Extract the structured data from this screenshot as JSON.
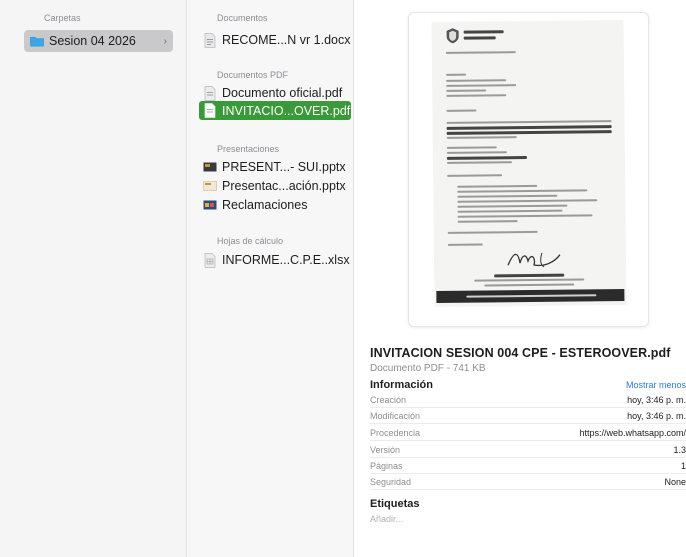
{
  "col1": {
    "header": "Carpetas",
    "folder": "Sesion 04 2026"
  },
  "col2": {
    "sections": [
      {
        "title": "Documentos",
        "items": [
          {
            "name": "RECOME...N vr 1.docx",
            "icon": "docx-file-icon"
          }
        ]
      },
      {
        "title": "Documentos PDF",
        "items": [
          {
            "name": "Documento oficial.pdf",
            "icon": "pdf-file-icon"
          },
          {
            "name": "INVITACIO...OVER.pdf",
            "icon": "pdf-file-icon",
            "selected": true
          }
        ]
      },
      {
        "title": "Presentaciones",
        "items": [
          {
            "name": "PRESENT...- SUI.pptx",
            "icon": "pptx-file-icon"
          },
          {
            "name": "Presentac...ación.pptx",
            "icon": "pptx-file-icon"
          },
          {
            "name": "Reclamaciones",
            "icon": "keynote-file-icon"
          }
        ]
      },
      {
        "title": "Hojas de cálculo",
        "items": [
          {
            "name": "INFORME...C.P.E..xlsx",
            "icon": "xlsx-file-icon"
          }
        ]
      }
    ]
  },
  "preview": {
    "title": "INVITACION  SESION  004  CPE - ESTEROOVER.pdf",
    "subtitle": "Documento PDF - 741 KB",
    "info_label": "Información",
    "show_less": "Mostrar menos",
    "info": [
      {
        "k": "Creación",
        "v": "hoy, 3:46 p. m."
      },
      {
        "k": "Modificación",
        "v": "hoy, 3:46 p. m."
      },
      {
        "k": "Procedencia",
        "v": "https://web.whatsapp.com/"
      },
      {
        "k": "Versión",
        "v": "1.3"
      },
      {
        "k": "Páginas",
        "v": "1"
      },
      {
        "k": "Seguridad",
        "v": "None"
      }
    ],
    "tags_label": "Etiquetas",
    "tags_placeholder": "Añadir..."
  },
  "colors": {
    "selection": "#3a9a3a",
    "link": "#2f7bd6"
  }
}
